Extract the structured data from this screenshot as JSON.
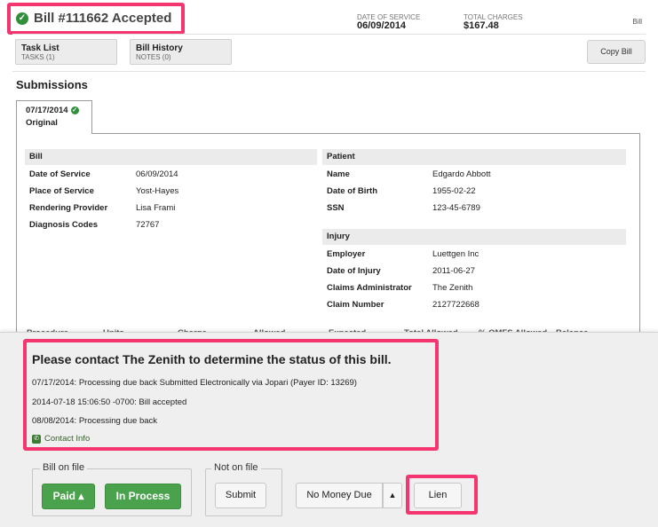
{
  "header": {
    "title": "Bill #111662 Accepted",
    "date_of_service_label": "DATE OF SERVICE",
    "date_of_service": "06/09/2014",
    "total_charges_label": "TOTAL CHARGES",
    "total_charges": "$167.48",
    "corner_label": "Bill"
  },
  "tabs": [
    {
      "label": "Task List",
      "sub": "TASKS (1)"
    },
    {
      "label": "Bill History",
      "sub": "NOTES (0)"
    }
  ],
  "copy_bill_label": "Copy Bill",
  "submissions": {
    "title": "Submissions",
    "tab_date": "07/17/2014",
    "tab_label": "Original"
  },
  "bill": {
    "heading": "Bill",
    "rows": [
      {
        "label": "Date of Service",
        "value": "06/09/2014"
      },
      {
        "label": "Place of Service",
        "value": "Yost-Hayes"
      },
      {
        "label": "Rendering Provider",
        "value": "Lisa Frami"
      },
      {
        "label": "Diagnosis Codes",
        "value": "72767"
      }
    ]
  },
  "patient": {
    "heading": "Patient",
    "rows": [
      {
        "label": "Name",
        "value": "Edgardo Abbott"
      },
      {
        "label": "Date of Birth",
        "value": "1955-02-22"
      },
      {
        "label": "SSN",
        "value": "123-45-6789"
      }
    ]
  },
  "injury": {
    "heading": "Injury",
    "rows": [
      {
        "label": "Employer",
        "value": "Luettgen Inc"
      },
      {
        "label": "Date of Injury",
        "value": "2011-06-27"
      },
      {
        "label": "Claims Administrator",
        "value": "The Zenith"
      },
      {
        "label": "Claim Number",
        "value": "2127722668"
      }
    ]
  },
  "procedure_columns": [
    "Procedure",
    "Units",
    "Charge",
    "Allowed",
    "Expected",
    "Total Allowed",
    "% OMFS Allowed",
    "Balance"
  ],
  "status_panel": {
    "title": "Please contact The Zenith to determine the status of this bill.",
    "events": [
      "07/17/2014: Processing due back Submitted Electronically via Jopari (Payer ID: 13269)",
      "2014-07-18 15:06:50 -0700: Bill accepted",
      "08/08/2014: Processing due back"
    ],
    "contact_info_label": "Contact Info"
  },
  "actions": {
    "bill_on_file_legend": "Bill on file",
    "paid_label": "Paid ▴",
    "in_process_label": "In Process",
    "not_on_file_legend": "Not on file",
    "submit_label": "Submit",
    "no_money_due_label": "No Money Due",
    "lien_label": "Lien"
  },
  "colors": {
    "accent_highlight": "#f5356f",
    "success_green": "#4aa34c",
    "check_green": "#2f8f3a"
  }
}
